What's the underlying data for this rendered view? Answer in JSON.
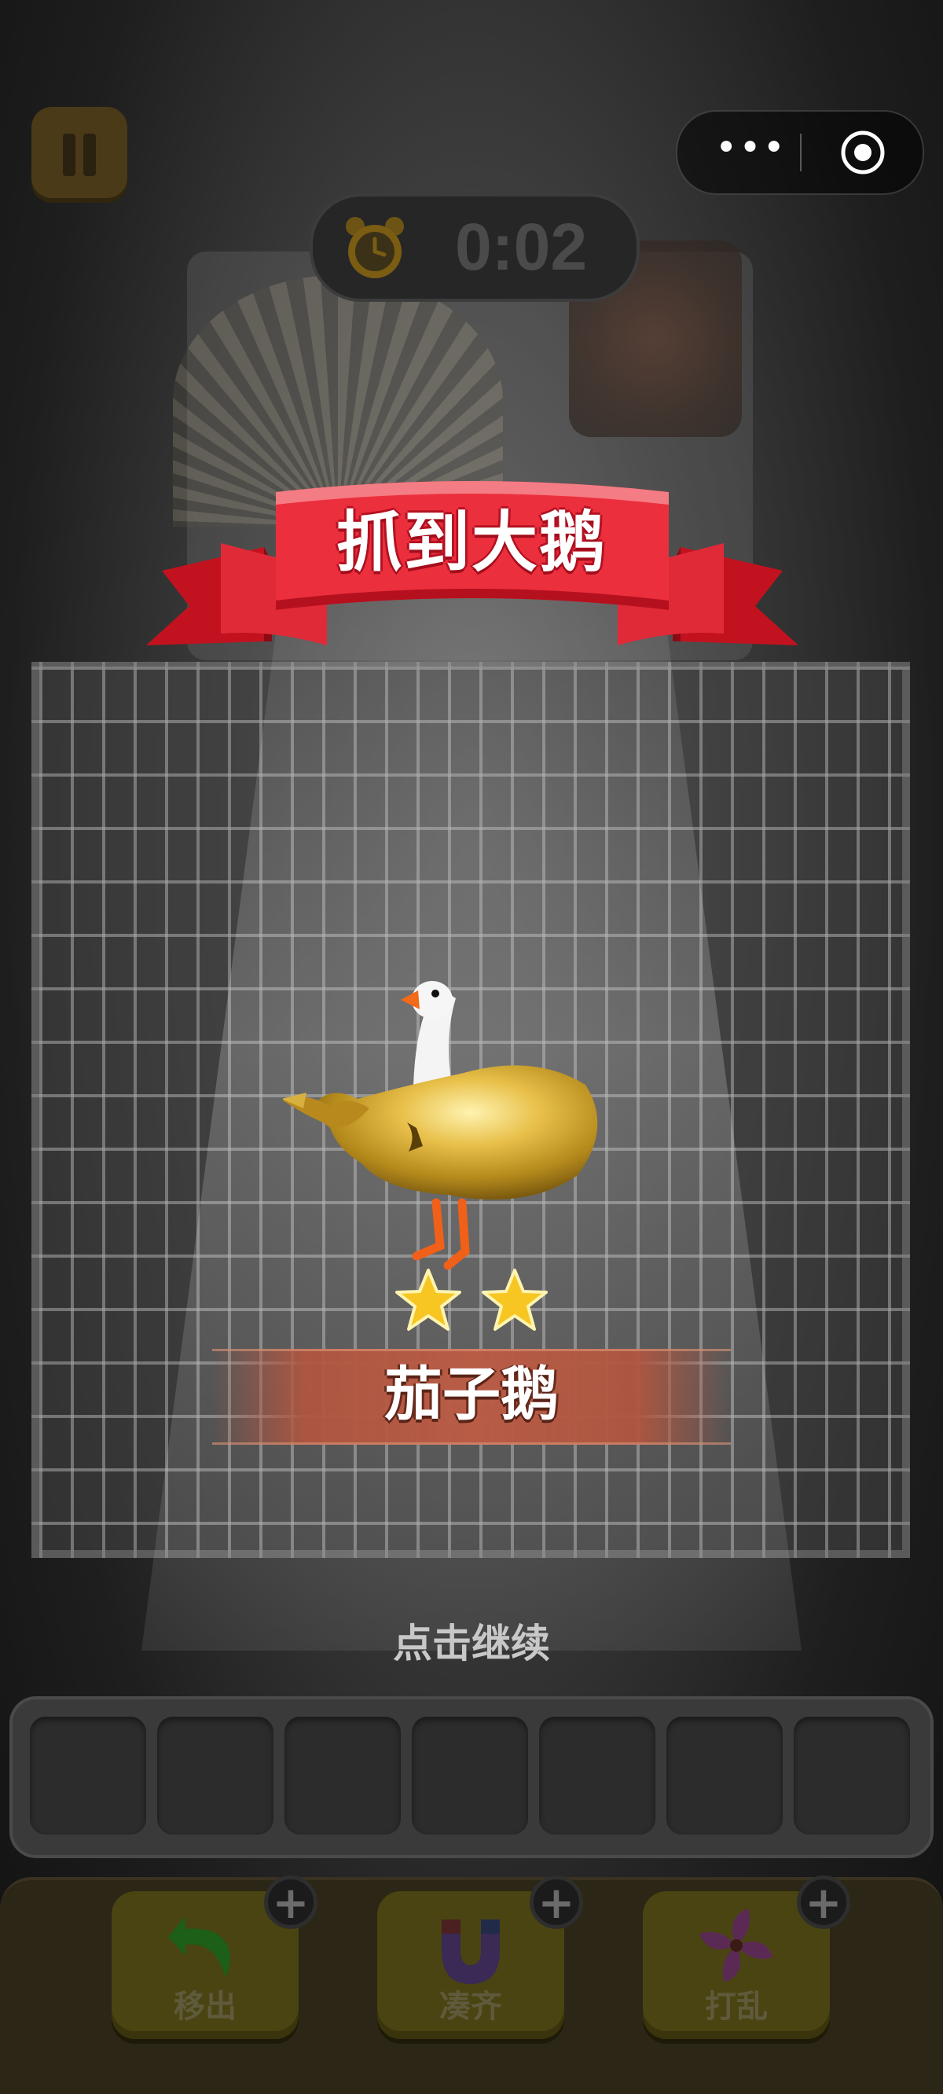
{
  "hud": {
    "timer": "0:02",
    "capsule_more": "•••"
  },
  "banner": {
    "title": "抓到大鹅"
  },
  "reward": {
    "name": "茄子鹅",
    "stars": 2
  },
  "prompt": {
    "continue": "点击继续"
  },
  "tray": {
    "slots": 7
  },
  "tools": [
    {
      "label": "移出",
      "icon": "undo-arrow-icon",
      "add": "+"
    },
    {
      "label": "凑齐",
      "icon": "magnet-icon",
      "add": "+"
    },
    {
      "label": "打乱",
      "icon": "pinwheel-icon",
      "add": "+"
    }
  ],
  "colors": {
    "ribbon_red": "#e8283a",
    "gold": "#d9a92a",
    "name_plate": "#b85c46"
  }
}
